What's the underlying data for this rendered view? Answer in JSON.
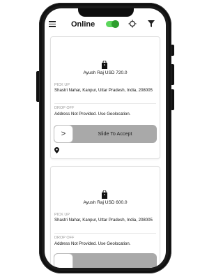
{
  "header": {
    "title": "Online",
    "online_toggle": true
  },
  "orders": [
    {
      "rider_summary": "Ayush Raj USD 720.0",
      "pickup_label": "PICK UP",
      "pickup_address": "Shastri Nahar, Kanpur, Uttar Pradesh, India, 208005",
      "dropoff_label": "DROP OFF",
      "dropoff_address": "Address Not Provided. Use Geolocation.",
      "slider_handle": ">",
      "slider_text": "Slide To Accept"
    },
    {
      "rider_summary": "Ayush Raj USD 600.0",
      "pickup_label": "PICK UP",
      "pickup_address": "Shastri Nahar, Kanpur, Uttar Pradesh, India, 208005",
      "dropoff_label": "DROP OFF",
      "dropoff_address": "Address Not Provided. Use Geolocation."
    }
  ],
  "icons": {
    "menu": "menu-icon",
    "location": "crosshair-icon",
    "filter": "filter-icon",
    "bag": "shopping-bag-icon",
    "pin": "map-pin-icon"
  },
  "colors": {
    "toggle_on": "#5cd65c",
    "slider": "#a9a9a9"
  }
}
